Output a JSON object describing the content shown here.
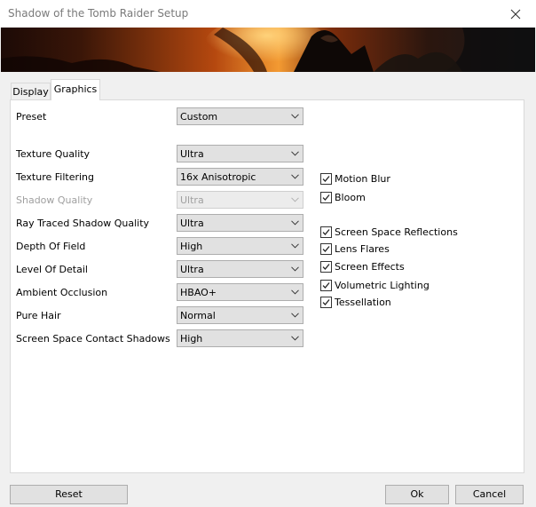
{
  "window": {
    "title": "Shadow of the Tomb Raider Setup"
  },
  "tabs": [
    {
      "label": "Display",
      "active": false
    },
    {
      "label": "Graphics",
      "active": true
    }
  ],
  "settings": [
    {
      "label": "Preset",
      "value": "Custom",
      "enabled": true
    },
    {
      "label": "Texture Quality",
      "value": "Ultra",
      "enabled": true
    },
    {
      "label": "Texture Filtering",
      "value": "16x Anisotropic",
      "enabled": true
    },
    {
      "label": "Shadow Quality",
      "value": "Ultra",
      "enabled": false
    },
    {
      "label": "Ray Traced Shadow Quality",
      "value": "Ultra",
      "enabled": true
    },
    {
      "label": "Depth Of Field",
      "value": "High",
      "enabled": true
    },
    {
      "label": "Level Of Detail",
      "value": "Ultra",
      "enabled": true
    },
    {
      "label": "Ambient Occlusion",
      "value": "HBAO+",
      "enabled": true
    },
    {
      "label": "Pure Hair",
      "value": "Normal",
      "enabled": true
    },
    {
      "label": "Screen Space Contact Shadows",
      "value": "High",
      "enabled": true
    }
  ],
  "checkboxes": [
    {
      "label": "Motion Blur",
      "checked": true
    },
    {
      "label": "Bloom",
      "checked": true
    },
    {
      "label": "Screen Space Reflections",
      "checked": true
    },
    {
      "label": "Lens Flares",
      "checked": true
    },
    {
      "label": "Screen Effects",
      "checked": true
    },
    {
      "label": "Volumetric Lighting",
      "checked": true
    },
    {
      "label": "Tessellation",
      "checked": true
    }
  ],
  "buttons": {
    "reset": "Reset",
    "ok": "Ok",
    "cancel": "Cancel"
  },
  "icons": {
    "close": "close-icon",
    "dropdown": "chevron-down-icon",
    "check": "checkmark-icon"
  },
  "colors": {
    "window_bg": "#f0f0f0",
    "panel_bg": "#ffffff",
    "control_bg": "#e1e1e1",
    "disabled_text": "#a0a0a0",
    "banner_orange": "#f08a2a"
  }
}
